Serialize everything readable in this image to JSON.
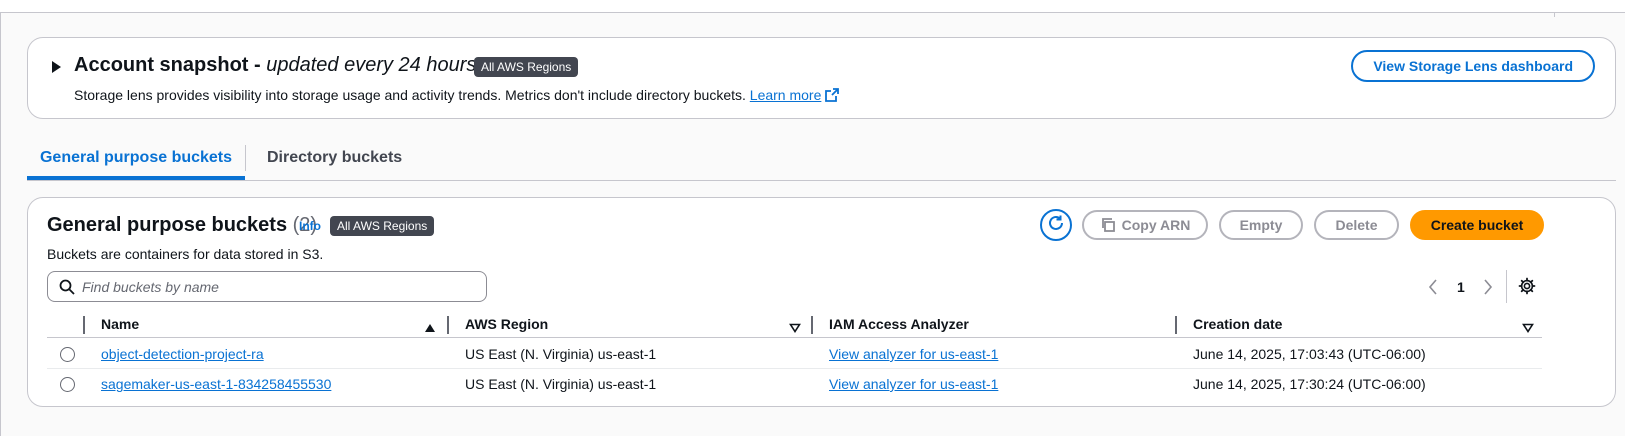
{
  "snapshot": {
    "title": "Account snapshot - ",
    "title_italic": "updated every 24 hours",
    "badge": "All AWS Regions",
    "description": "Storage lens provides visibility into storage usage and activity trends. Metrics don't include directory buckets.",
    "learn_more": "Learn more",
    "dashboard_button": "View Storage Lens dashboard"
  },
  "tabs": [
    {
      "label": "General purpose buckets",
      "active": true
    },
    {
      "label": "Directory buckets",
      "active": false
    }
  ],
  "panel": {
    "title": "General purpose buckets",
    "count": "(2)",
    "info": "Info",
    "badge": "All AWS Regions",
    "description": "Buckets are containers for data stored in S3.",
    "buttons": {
      "copy_arn": "Copy ARN",
      "empty": "Empty",
      "delete": "Delete",
      "create": "Create bucket"
    },
    "search_placeholder": "Find buckets by name",
    "page": "1"
  },
  "table": {
    "columns": [
      "Name",
      "AWS Region",
      "IAM Access Analyzer",
      "Creation date"
    ],
    "rows": [
      {
        "name": "object-detection-project-ra",
        "region": "US East (N. Virginia) us-east-1",
        "iam": "View analyzer for us-east-1",
        "date": "June 14, 2025, 17:03:43 (UTC-06:00)"
      },
      {
        "name": "sagemaker-us-east-1-834258455530",
        "region": "US East (N. Virginia) us-east-1",
        "iam": "View analyzer for us-east-1",
        "date": "June 14, 2025, 17:30:24 (UTC-06:00)"
      }
    ]
  },
  "colors": {
    "accent": "#0972d3",
    "primary_button": "#ff9900",
    "badge": "#424650"
  }
}
